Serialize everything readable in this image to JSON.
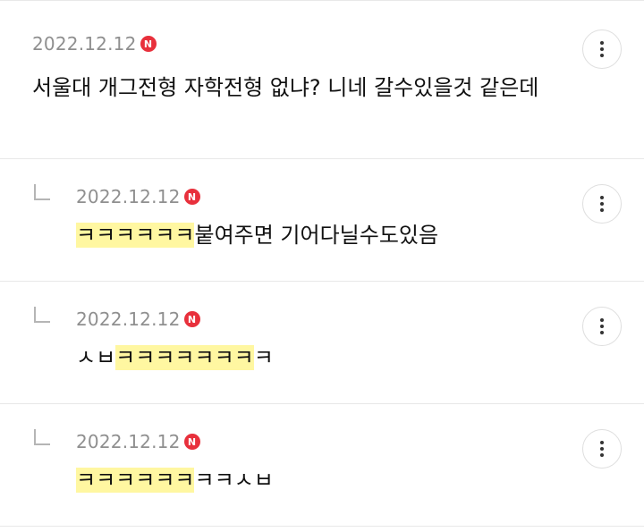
{
  "comments": [
    {
      "date": "2022.12.12",
      "badge": "N",
      "text_parts": [
        {
          "text": "서울대 개그전형 자학전형 없냐? 니네 갈수있을것 같은데",
          "highlight": false
        }
      ]
    }
  ],
  "replies": [
    {
      "date": "2022.12.12",
      "badge": "N",
      "text_parts": [
        {
          "text": "ㅋㅋㅋㅋㅋㅋ",
          "highlight": true
        },
        {
          "text": "붙여주면 기어다닐수도있음",
          "highlight": false
        }
      ]
    },
    {
      "date": "2022.12.12",
      "badge": "N",
      "text_parts": [
        {
          "text": "ㅅㅂ",
          "highlight": false
        },
        {
          "text": "ㅋㅋㅋㅋㅋㅋㅋ",
          "highlight": true
        },
        {
          "text": "ㅋ",
          "highlight": false
        }
      ]
    },
    {
      "date": "2022.12.12",
      "badge": "N",
      "text_parts": [
        {
          "text": "ㅋㅋㅋㅋㅋㅋ",
          "highlight": true
        },
        {
          "text": "ㅋㅋㅅㅂ",
          "highlight": false
        }
      ]
    }
  ],
  "icons": {
    "more": "more-vertical-icon",
    "reply": "reply-arrow-icon",
    "new_badge": "new-badge-icon"
  },
  "colors": {
    "badge": "#e8303c",
    "highlight": "#fff7a1",
    "date": "#8f8f8f"
  }
}
